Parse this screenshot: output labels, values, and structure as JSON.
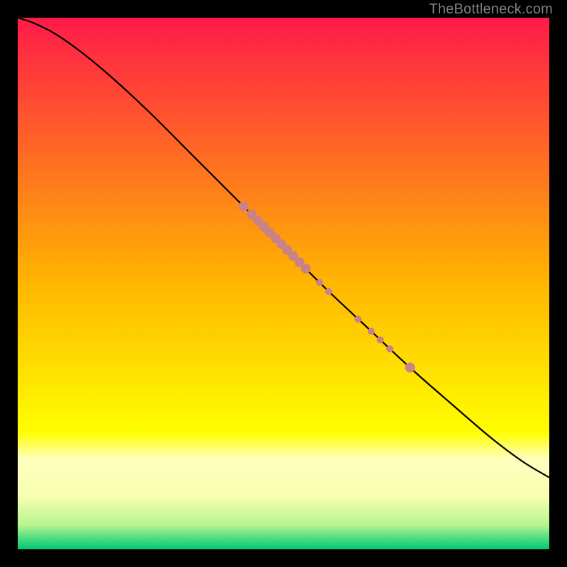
{
  "watermark": "TheBottleneck.com",
  "chart_data": {
    "type": "line",
    "title": "",
    "xlabel": "",
    "ylabel": "",
    "xlim": [
      0,
      100
    ],
    "ylim": [
      0,
      100
    ],
    "grid": false,
    "background_gradient": {
      "stops": [
        {
          "offset": 0.0,
          "color": "#ff1a49"
        },
        {
          "offset": 0.5,
          "color": "#ffb600"
        },
        {
          "offset": 0.78,
          "color": "#ffff00"
        },
        {
          "offset": 0.83,
          "color": "#ffffbe"
        },
        {
          "offset": 0.9,
          "color": "#f7ffb0"
        },
        {
          "offset": 0.955,
          "color": "#b6f58e"
        },
        {
          "offset": 0.975,
          "color": "#5ee082"
        },
        {
          "offset": 1.0,
          "color": "#00c878"
        }
      ]
    },
    "series": [
      {
        "name": "curve",
        "type": "line",
        "color": "#000000",
        "points": [
          {
            "x": 0,
            "y": 100.0
          },
          {
            "x": 3,
            "y": 99.0
          },
          {
            "x": 7,
            "y": 97.0
          },
          {
            "x": 12,
            "y": 93.5
          },
          {
            "x": 18,
            "y": 88.5
          },
          {
            "x": 25,
            "y": 82.0
          },
          {
            "x": 33,
            "y": 74.0
          },
          {
            "x": 42,
            "y": 65.0
          },
          {
            "x": 50,
            "y": 57.0
          },
          {
            "x": 58,
            "y": 49.0
          },
          {
            "x": 66,
            "y": 41.5
          },
          {
            "x": 74,
            "y": 34.0
          },
          {
            "x": 82,
            "y": 27.0
          },
          {
            "x": 89,
            "y": 21.0
          },
          {
            "x": 95,
            "y": 16.5
          },
          {
            "x": 100,
            "y": 13.5
          }
        ]
      },
      {
        "name": "cluster-points",
        "type": "scatter",
        "color": "#c98384",
        "radius_major": 7,
        "radius_minor": 5,
        "points": [
          {
            "x": 42.5,
            "y": 64.5,
            "r": "major"
          },
          {
            "x": 44.0,
            "y": 63.0,
            "r": "major"
          },
          {
            "x": 45.2,
            "y": 61.8,
            "r": "major"
          },
          {
            "x": 46.3,
            "y": 60.7,
            "r": "major"
          },
          {
            "x": 47.4,
            "y": 59.6,
            "r": "major"
          },
          {
            "x": 48.5,
            "y": 58.5,
            "r": "major"
          },
          {
            "x": 49.6,
            "y": 57.4,
            "r": "major"
          },
          {
            "x": 50.7,
            "y": 56.3,
            "r": "major"
          },
          {
            "x": 51.8,
            "y": 55.2,
            "r": "major"
          },
          {
            "x": 53.0,
            "y": 54.0,
            "r": "major"
          },
          {
            "x": 54.2,
            "y": 52.8,
            "r": "major"
          },
          {
            "x": 56.8,
            "y": 50.2,
            "r": "minor"
          },
          {
            "x": 58.5,
            "y": 48.5,
            "r": "minor"
          },
          {
            "x": 64.0,
            "y": 43.3,
            "r": "minor"
          },
          {
            "x": 66.5,
            "y": 41.0,
            "r": "minor"
          },
          {
            "x": 68.2,
            "y": 39.4,
            "r": "minor"
          },
          {
            "x": 70.0,
            "y": 37.7,
            "r": "minor"
          },
          {
            "x": 73.8,
            "y": 34.2,
            "r": "major"
          }
        ]
      }
    ]
  }
}
